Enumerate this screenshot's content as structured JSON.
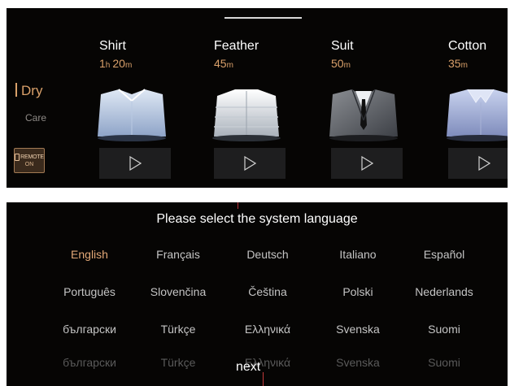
{
  "top": {
    "nav": {
      "dry_label": "Dry",
      "care_label": "Care"
    },
    "remote": {
      "label": "REMOTE",
      "state": "ON"
    },
    "programs": [
      {
        "name": "Shirt",
        "time_h": "1",
        "unit_h": "h",
        "time_m": "20",
        "unit_m": "m",
        "garment": "shirt"
      },
      {
        "name": "Feather",
        "time_h": "",
        "unit_h": "",
        "time_m": "45",
        "unit_m": "m",
        "garment": "jacket"
      },
      {
        "name": "Suit",
        "time_h": "",
        "unit_h": "",
        "time_m": "50",
        "unit_m": "m",
        "garment": "suit"
      },
      {
        "name": "Cotton",
        "time_h": "",
        "unit_h": "",
        "time_m": "35",
        "unit_m": "m",
        "garment": "cotton"
      }
    ]
  },
  "language": {
    "title": "Please select the system language",
    "selected": "English",
    "rows": [
      [
        "English",
        "Français",
        "Deutsch",
        "Italiano",
        "Español"
      ],
      [
        "Português",
        "Slovenčina",
        "Čeština",
        "Polski",
        "Nederlands"
      ],
      [
        "български",
        "Türkçe",
        "Ελληνικά",
        "Svenska",
        "Suomi"
      ],
      [
        "български",
        "Türkçe",
        "Ελληνικά",
        "Svenska",
        "Suomi"
      ]
    ],
    "next_label": "next"
  },
  "colors": {
    "accent": "#d9a06a",
    "background": "#060504",
    "button": "#1e1e1f"
  }
}
